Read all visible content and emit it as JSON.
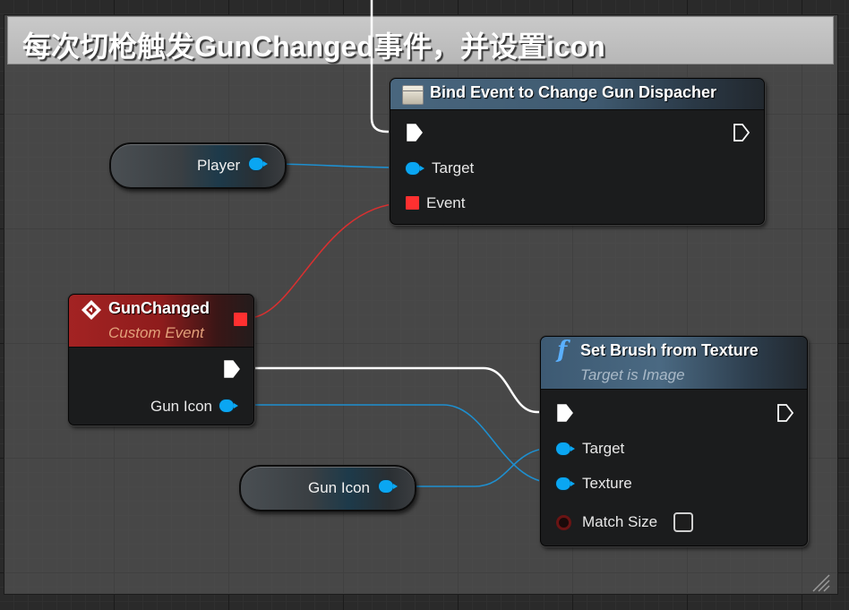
{
  "comment": {
    "title": "每次切枪触发GunChanged事件，并设置icon"
  },
  "bind_event_node": {
    "title": "Bind Event to Change Gun Dispacher",
    "pins": {
      "target": "Target",
      "event": "Event"
    },
    "header_icon": "delegate-icon"
  },
  "player_node": {
    "label": "Player"
  },
  "gun_changed_node": {
    "title": "GunChanged",
    "subtitle": "Custom Event",
    "output_pin": "Gun Icon",
    "header_icon": "event-diamond-icon"
  },
  "set_brush_node": {
    "title": "Set Brush from Texture",
    "subtitle": "Target is Image",
    "pins": {
      "target": "Target",
      "texture": "Texture",
      "match_size": "Match Size"
    },
    "header_icon": "function-icon"
  },
  "gun_icon_var_node": {
    "label": "Gun Icon"
  },
  "colors": {
    "object_pin": "#0aa6f2",
    "delegate_pin": "#ff3030",
    "exec_wire": "#ffffff",
    "event_header": "#a32323",
    "function_header": "#49667e"
  }
}
